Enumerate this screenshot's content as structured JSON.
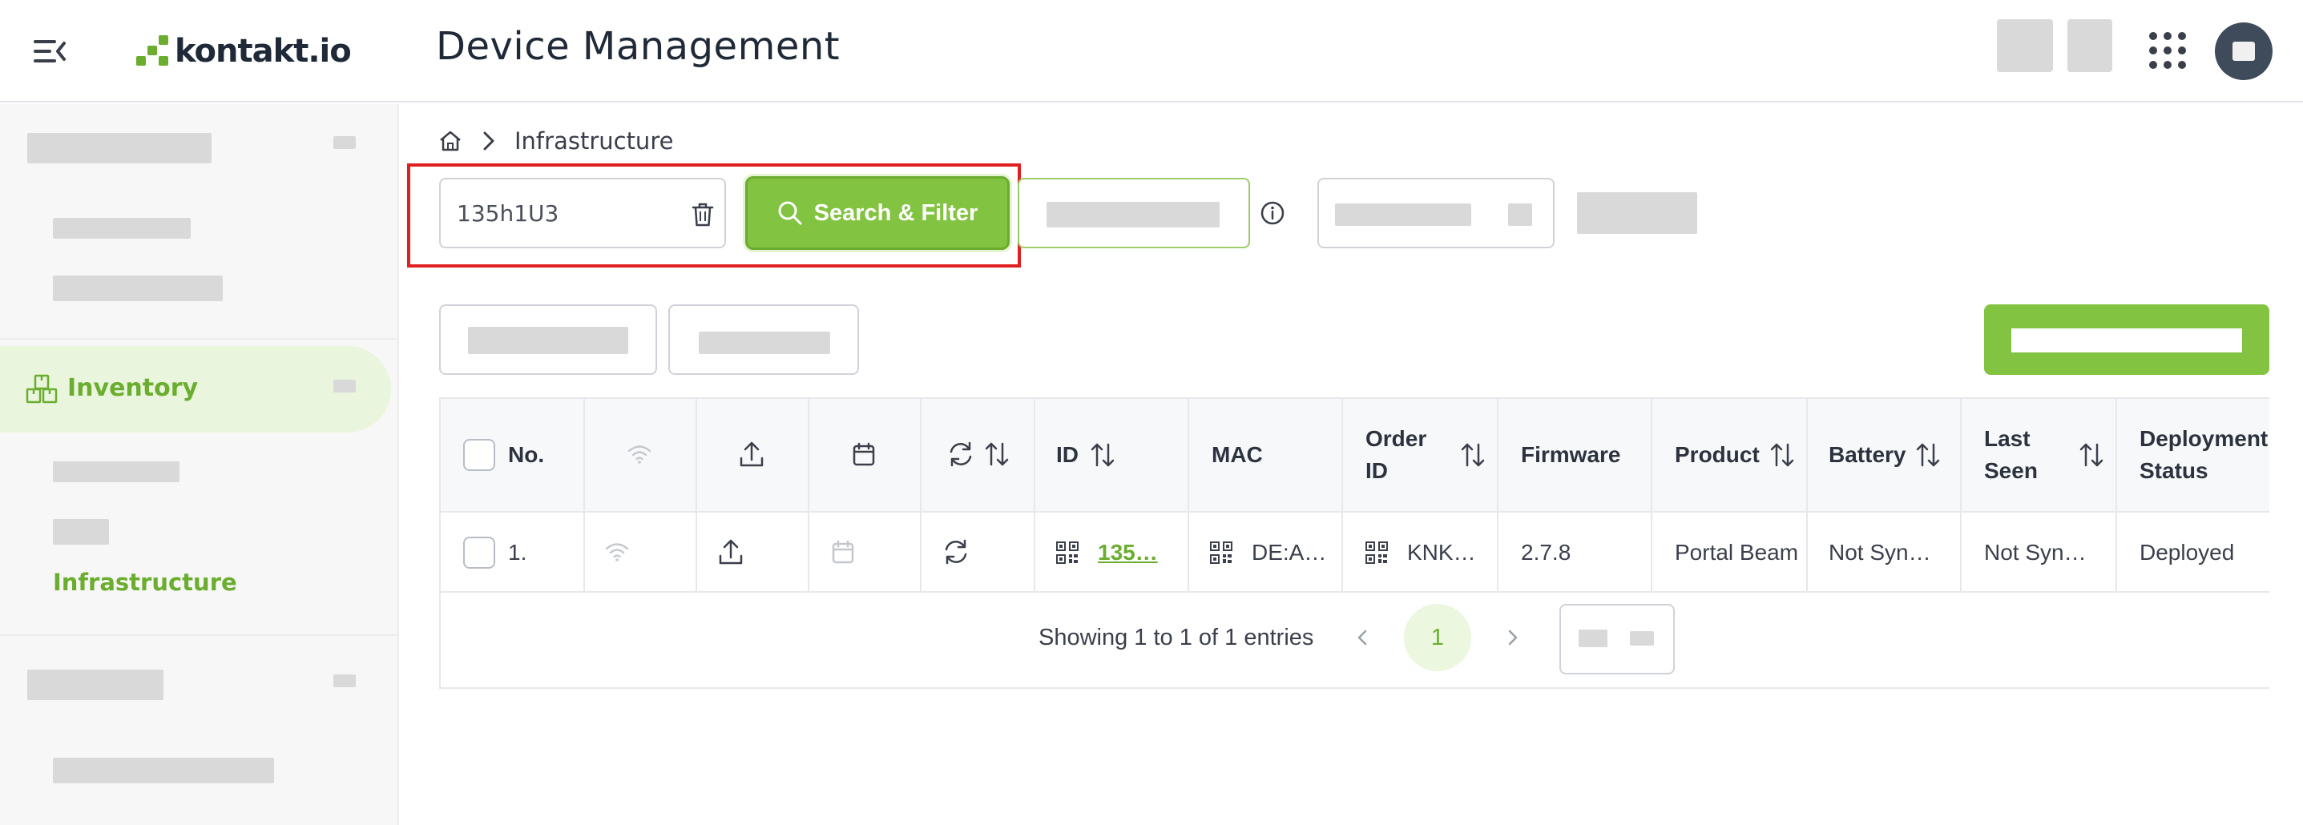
{
  "header": {
    "logo_text": "kontakt.io",
    "page_title": "Device Management"
  },
  "sidebar": {
    "active_section": "Inventory",
    "active_subitem": "Infrastructure"
  },
  "breadcrumb": {
    "current": "Infrastructure"
  },
  "search": {
    "value": "135h1U3",
    "button_label": "Search & Filter"
  },
  "table": {
    "columns": {
      "no": "No.",
      "id": "ID",
      "mac": "MAC",
      "order_id_line1": "Order",
      "order_id_line2": "ID",
      "firmware": "Firmware",
      "product": "Product",
      "battery": "Battery",
      "last_seen_line1": "Last",
      "last_seen_line2": "Seen",
      "deployment_line1": "Deployment",
      "deployment_line2": "Status"
    },
    "rows": [
      {
        "no": "1.",
        "id": "135…",
        "mac": "DE:A…",
        "order_id": "KNK…",
        "firmware": "2.7.8",
        "product": "Portal Beam",
        "battery": "Not Syn…",
        "last_seen": "Not Syn…",
        "deployment": "Deployed"
      }
    ]
  },
  "pagination": {
    "summary": "Showing 1 to 1 of 1 entries",
    "current_page": "1"
  },
  "colors": {
    "brand_green": "#82c341",
    "highlight_red": "#e02020"
  }
}
